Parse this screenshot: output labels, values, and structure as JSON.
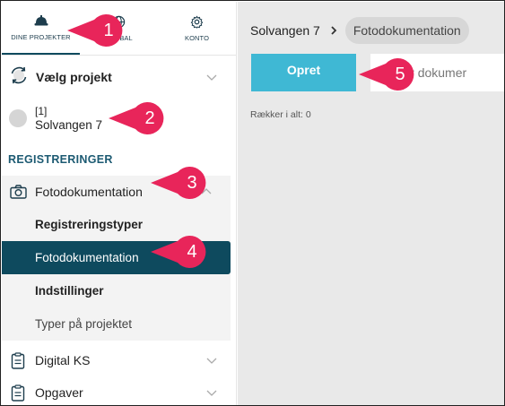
{
  "topnav": {
    "items": [
      {
        "label": "DINE PROJEKTER",
        "icon": "hard-hat-icon"
      },
      {
        "label": "GLOBAL",
        "icon": "globe-icon"
      },
      {
        "label": "KONTO",
        "icon": "gear-icon"
      }
    ]
  },
  "sidebar": {
    "project_select_label": "Vælg projekt",
    "current_project": {
      "number": "[1]",
      "name": "Solvangen 7"
    },
    "section_title": "REGISTRERINGER",
    "group_open": {
      "label": "Fotodokumentation",
      "items": [
        {
          "label": "Registreringstyper"
        },
        {
          "label": "Fotodokumentation"
        },
        {
          "label": "Indstillinger"
        },
        {
          "label": "Typer på projektet"
        }
      ]
    },
    "groups": [
      {
        "label": "Digital KS"
      },
      {
        "label": "Opgaver"
      }
    ]
  },
  "main": {
    "breadcrumb": [
      "Solvangen 7",
      "Fotodokumentation"
    ],
    "create_button": "Opret",
    "search_placeholder": "Søg efter dokumenter",
    "search_visible": "ig efter dokumer",
    "rows_count": "Rækker i alt: 0"
  },
  "callouts": [
    "1",
    "2",
    "3",
    "4",
    "5"
  ],
  "colors": {
    "accent": "#0e4a5e",
    "button": "#3fb8d4",
    "callout": "#e8255a",
    "section": "#1c5a72"
  }
}
